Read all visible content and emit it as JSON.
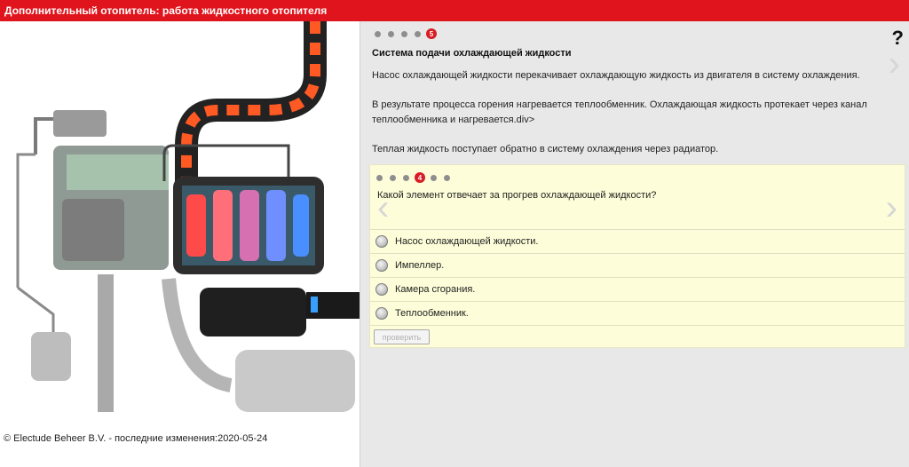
{
  "header": {
    "title": "Дополнительный отопитель: работа жидкостного отопителя"
  },
  "left": {
    "copyright": "© Electude Beheer B.V. - последние изменения:2020-05-24"
  },
  "info": {
    "page_number": "5",
    "title": "Система подачи охлаждающей жидкости",
    "p1": "Насос охлаждающей жидкости перекачивает охлаждающую жидкость из двигателя в систему охлаждения.",
    "p2": "В результате процесса горения нагревается теплообменник. Охлаждающая жидкость протекает через канал теплообменника и нагревается.div>",
    "p3": "Теплая жидкость поступает обратно в систему охлаждения через радиатор.",
    "help": "?"
  },
  "quiz": {
    "page_number": "4",
    "question": "Какой элемент отвечает за прогрев охлаждающей жидкости?",
    "options": [
      "Насос охлаждающей жидкости.",
      "Импеллер.",
      "Камера сгорания.",
      "Теплообменник."
    ],
    "check_label": "проверить"
  },
  "colors": {
    "header": "#e0141c",
    "accent": "#d81d24",
    "panel": "#e8e8e8",
    "quiz_bg": "#fdfdd9"
  }
}
